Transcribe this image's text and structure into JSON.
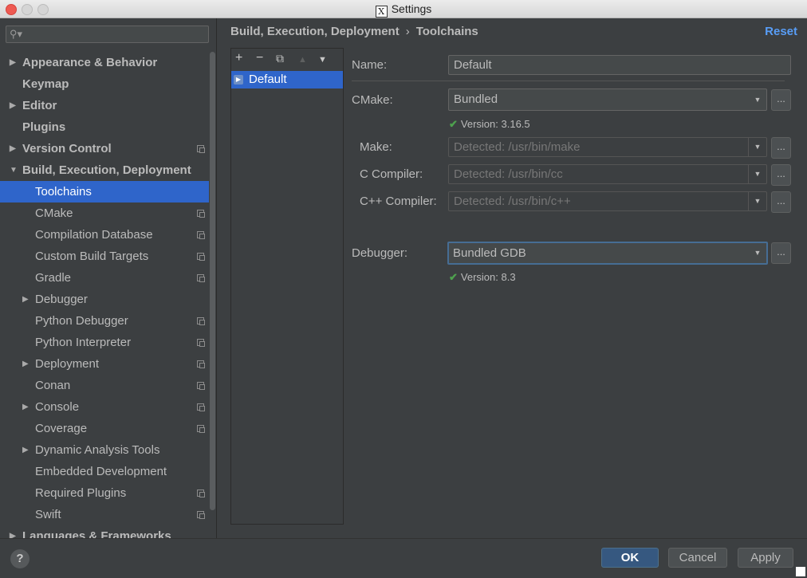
{
  "window": {
    "title": "Settings"
  },
  "search": {
    "placeholder": ""
  },
  "tree": [
    {
      "label": "Appearance & Behavior",
      "level": 0,
      "arrow": "right",
      "bold": true,
      "proj": false,
      "selected": false
    },
    {
      "label": "Keymap",
      "level": 0,
      "arrow": "",
      "bold": true,
      "proj": false,
      "selected": false
    },
    {
      "label": "Editor",
      "level": 0,
      "arrow": "right",
      "bold": true,
      "proj": false,
      "selected": false
    },
    {
      "label": "Plugins",
      "level": 0,
      "arrow": "",
      "bold": true,
      "proj": false,
      "selected": false
    },
    {
      "label": "Version Control",
      "level": 0,
      "arrow": "right",
      "bold": true,
      "proj": true,
      "selected": false
    },
    {
      "label": "Build, Execution, Deployment",
      "level": 0,
      "arrow": "down",
      "bold": true,
      "proj": false,
      "selected": false
    },
    {
      "label": "Toolchains",
      "level": 1,
      "arrow": "",
      "bold": false,
      "proj": false,
      "selected": true
    },
    {
      "label": "CMake",
      "level": 1,
      "arrow": "",
      "bold": false,
      "proj": true,
      "selected": false
    },
    {
      "label": "Compilation Database",
      "level": 1,
      "arrow": "",
      "bold": false,
      "proj": true,
      "selected": false
    },
    {
      "label": "Custom Build Targets",
      "level": 1,
      "arrow": "",
      "bold": false,
      "proj": true,
      "selected": false
    },
    {
      "label": "Gradle",
      "level": 1,
      "arrow": "",
      "bold": false,
      "proj": true,
      "selected": false
    },
    {
      "label": "Debugger",
      "level": 1,
      "arrow": "right",
      "bold": false,
      "proj": false,
      "selected": false
    },
    {
      "label": "Python Debugger",
      "level": 1,
      "arrow": "",
      "bold": false,
      "proj": true,
      "selected": false
    },
    {
      "label": "Python Interpreter",
      "level": 1,
      "arrow": "",
      "bold": false,
      "proj": true,
      "selected": false
    },
    {
      "label": "Deployment",
      "level": 1,
      "arrow": "right",
      "bold": false,
      "proj": true,
      "selected": false
    },
    {
      "label": "Conan",
      "level": 1,
      "arrow": "",
      "bold": false,
      "proj": true,
      "selected": false
    },
    {
      "label": "Console",
      "level": 1,
      "arrow": "right",
      "bold": false,
      "proj": true,
      "selected": false
    },
    {
      "label": "Coverage",
      "level": 1,
      "arrow": "",
      "bold": false,
      "proj": true,
      "selected": false
    },
    {
      "label": "Dynamic Analysis Tools",
      "level": 1,
      "arrow": "right",
      "bold": false,
      "proj": false,
      "selected": false
    },
    {
      "label": "Embedded Development",
      "level": 1,
      "arrow": "",
      "bold": false,
      "proj": false,
      "selected": false
    },
    {
      "label": "Required Plugins",
      "level": 1,
      "arrow": "",
      "bold": false,
      "proj": true,
      "selected": false
    },
    {
      "label": "Swift",
      "level": 1,
      "arrow": "",
      "bold": false,
      "proj": true,
      "selected": false
    },
    {
      "label": "Languages & Frameworks",
      "level": 0,
      "arrow": "right",
      "bold": true,
      "proj": false,
      "selected": false
    }
  ],
  "header": {
    "crumb_parent": "Build, Execution, Deployment",
    "crumb_sep": "›",
    "crumb_current": "Toolchains",
    "reset": "Reset"
  },
  "toolbar": {
    "add": "+",
    "remove": "−",
    "copy": "⧉",
    "up": "▲",
    "down": "▼"
  },
  "toolchains": [
    {
      "label": "Default"
    }
  ],
  "form": {
    "name_label": "Name:",
    "name_value": "Default",
    "cmake_label": "CMake:",
    "cmake_value": "Bundled",
    "cmake_version": "Version: 3.16.5",
    "make_label": "Make:",
    "make_value": "Detected: /usr/bin/make",
    "c_label": "C Compiler:",
    "c_value": "Detected: /usr/bin/cc",
    "cpp_label": "C++ Compiler:",
    "cpp_value": "Detected: /usr/bin/c++",
    "debugger_label": "Debugger:",
    "debugger_value": "Bundled GDB",
    "debugger_version": "Version: 8.3",
    "browse": "..."
  },
  "buttons": {
    "help": "?",
    "ok": "OK",
    "cancel": "Cancel",
    "apply": "Apply"
  },
  "colors": {
    "accent": "#2f65ca",
    "link": "#589df6",
    "check": "#4ea14e",
    "background": "#3c3f41"
  }
}
